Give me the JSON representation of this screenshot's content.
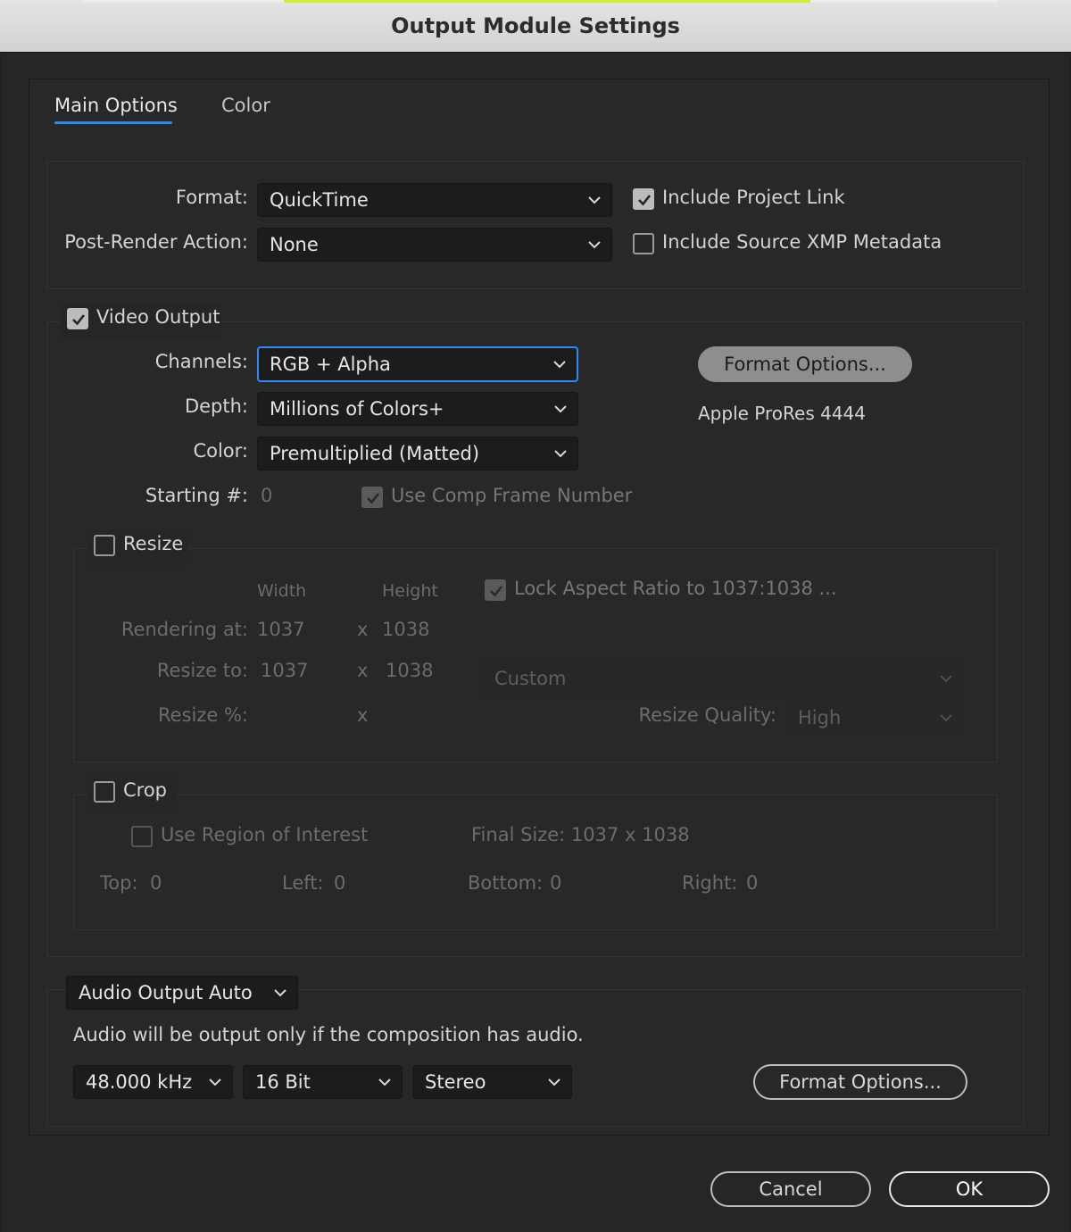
{
  "window": {
    "title": "Output Module Settings"
  },
  "tabs": [
    {
      "label": "Main Options",
      "active": true
    },
    {
      "label": "Color",
      "active": false
    }
  ],
  "general": {
    "format_label": "Format:",
    "format_value": "QuickTime",
    "post_render_label": "Post-Render Action:",
    "post_render_value": "None",
    "include_project_link_label": "Include Project Link",
    "include_project_link_checked": true,
    "include_xmp_label": "Include Source XMP Metadata",
    "include_xmp_checked": false
  },
  "video": {
    "section_label": "Video Output",
    "enabled": true,
    "channels_label": "Channels:",
    "channels_value": "RGB + Alpha",
    "depth_label": "Depth:",
    "depth_value": "Millions of Colors+",
    "color_label": "Color:",
    "color_value": "Premultiplied (Matted)",
    "starting_label": "Starting #:",
    "starting_value": "0",
    "use_comp_frame_label": "Use Comp Frame Number",
    "use_comp_frame_checked": true,
    "format_options_label": "Format Options...",
    "codec_text": "Apple ProRes 4444"
  },
  "resize": {
    "section_label": "Resize",
    "enabled": false,
    "width_header": "Width",
    "height_header": "Height",
    "lock_aspect_label": "Lock Aspect Ratio to 1037:1038 ...",
    "lock_aspect_checked": true,
    "rendering_at_label": "Rendering at:",
    "rendering_width": "1037",
    "rendering_height": "1038",
    "resize_to_label": "Resize to:",
    "resize_width": "1037",
    "resize_height": "1038",
    "x_sep": "x",
    "preset_value": "Custom",
    "resize_pct_label": "Resize %:",
    "quality_label": "Resize Quality:",
    "quality_value": "High"
  },
  "crop": {
    "section_label": "Crop",
    "enabled": false,
    "use_roi_label": "Use Region of Interest",
    "use_roi_checked": false,
    "final_size_text": "Final Size: 1037 x 1038",
    "top_label": "Top:",
    "top_value": "0",
    "left_label": "Left:",
    "left_value": "0",
    "bottom_label": "Bottom:",
    "bottom_value": "0",
    "right_label": "Right:",
    "right_value": "0"
  },
  "audio": {
    "mode_value": "Audio Output Auto",
    "info_text": "Audio will be output only if the composition has audio.",
    "sample_rate_value": "48.000 kHz",
    "bit_depth_value": "16 Bit",
    "channels_value": "Stereo",
    "format_options_label": "Format Options..."
  },
  "footer": {
    "cancel_label": "Cancel",
    "ok_label": "OK"
  },
  "colors": {
    "accent": "#2f8cf5",
    "background": "#262626",
    "titlebar": "#d8d8d8"
  }
}
